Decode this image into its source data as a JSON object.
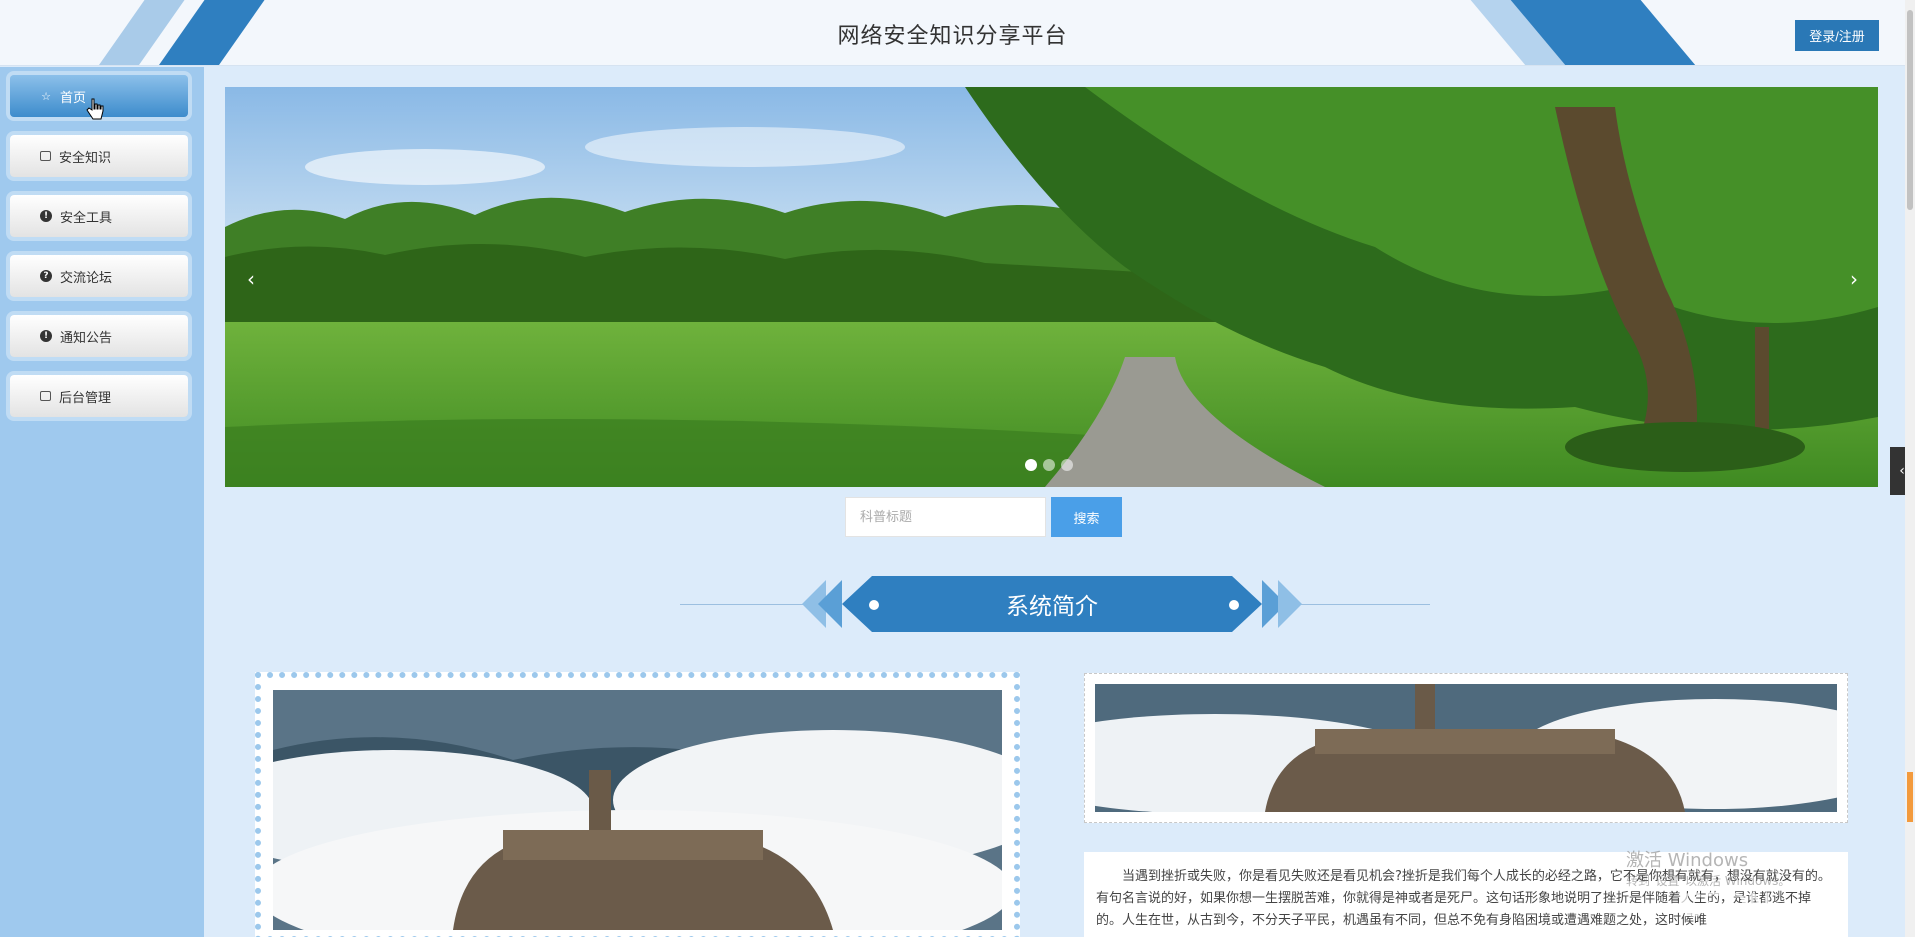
{
  "header": {
    "title": "网络安全知识分享平台",
    "login_label": "登录/注册"
  },
  "sidebar": {
    "items": [
      {
        "label": "首页",
        "icon": "star-icon"
      },
      {
        "label": "安全知识",
        "icon": "bag-icon"
      },
      {
        "label": "安全工具",
        "icon": "info-icon"
      },
      {
        "label": "交流论坛",
        "icon": "question-icon"
      },
      {
        "label": "通知公告",
        "icon": "info-icon"
      },
      {
        "label": "后台管理",
        "icon": "briefcase-icon"
      }
    ]
  },
  "banner": {
    "prev": "‹",
    "next": "›",
    "slides": 3,
    "active_slide": 1
  },
  "search": {
    "placeholder": "科普标题",
    "button_label": "搜索"
  },
  "section": {
    "title": "系统简介"
  },
  "intro": {
    "text": "当遇到挫折或失败，你是看见失败还是看见机会?挫折是我们每个人成长的必经之路，它不是你想有就有，想没有就没有的。有句名言说的好，如果你想一生摆脱苦难，你就得是神或者是死尸。这句话形象地说明了挫折是伴随着人生的，是谁都逃不掉的。人生在世，从古到今，不分天子平民，机遇虽有不同，但总不免有身陷困境或遭遇难题之处，这时候唯"
  },
  "side_tab": "‹",
  "watermark": {
    "activate_title": "激活 Windows",
    "activate_sub": "转到\"设置\"以激活 Windows。",
    "csdn": "CSDN @sheji715"
  },
  "colors": {
    "accent": "#2f7fc0",
    "sidebar": "#9fc9ee",
    "page_bg": "#dcebfa",
    "search_button": "#4a9fe8"
  }
}
